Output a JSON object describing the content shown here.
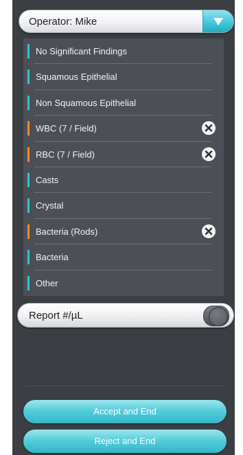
{
  "operator": {
    "label": "Operator: Mike",
    "dropdown_icon": "chevron-down-icon"
  },
  "findings": {
    "items": [
      {
        "label": "No Significant Findings",
        "accent": "#34c1d3",
        "removable": false
      },
      {
        "label": "Squamous Epithelial",
        "accent": "#34c1d3",
        "removable": false
      },
      {
        "label": "Non Squamous Epithelial",
        "accent": "#34c1d3",
        "removable": false
      },
      {
        "label": "WBC (7 / Field)",
        "accent": "#f08a2a",
        "removable": true
      },
      {
        "label": "RBC (7 / Field)",
        "accent": "#f08a2a",
        "removable": true
      },
      {
        "label": "Casts",
        "accent": "#34c1d3",
        "removable": false
      },
      {
        "label": "Crystal",
        "accent": "#34c1d3",
        "removable": false
      },
      {
        "label": "Bacteria (Rods)",
        "accent": "#f08a2a",
        "removable": true
      },
      {
        "label": "Bacteria",
        "accent": "#34c1d3",
        "removable": false
      },
      {
        "label": "Other",
        "accent": "#34c1d3",
        "removable": false
      }
    ]
  },
  "report": {
    "label": "Report #/µL",
    "toggle_on": false
  },
  "actions": {
    "accept_label": "Accept and End",
    "reject_label": "Reject and End"
  },
  "colors": {
    "panel": "#3b3e43",
    "list": "#4c5056",
    "cyan_accent": "#34c1d3",
    "orange_accent": "#f08a2a"
  }
}
